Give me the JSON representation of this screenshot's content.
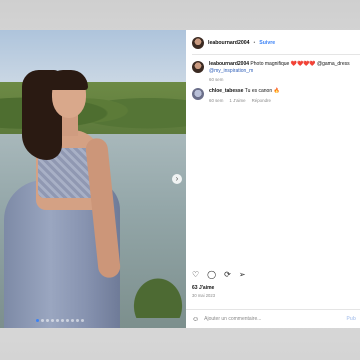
{
  "post": {
    "author": "leabournard2004",
    "separator": "•",
    "follow_label": "Suivre",
    "caption": {
      "author": "leabournard2004",
      "text": "Photo magnifique ❤️❤️❤️❤️ @gama_dress",
      "mention": "@my_inspiration_m",
      "time": "60 sem"
    },
    "comments": [
      {
        "author": "chloe_tabesse",
        "text": "Tu es canon 🔥",
        "time": "60 sem",
        "likes": "1 J'aime",
        "reply": "Répondre"
      }
    ],
    "likes_label": "63 J'aime",
    "date_label": "30 mai 2023",
    "add_comment_placeholder": "Ajouter un commentaire...",
    "publish_label": "Pub",
    "nav_arrow": "›"
  },
  "icons": {
    "like": "heart-icon",
    "comment": "comment-icon",
    "share": "send-icon",
    "emoji": "emoji-icon",
    "next": "chevron-right-icon"
  },
  "colors": {
    "link": "#3b82f6",
    "mention": "#2f5fb8",
    "muted": "#8a8a8a"
  }
}
